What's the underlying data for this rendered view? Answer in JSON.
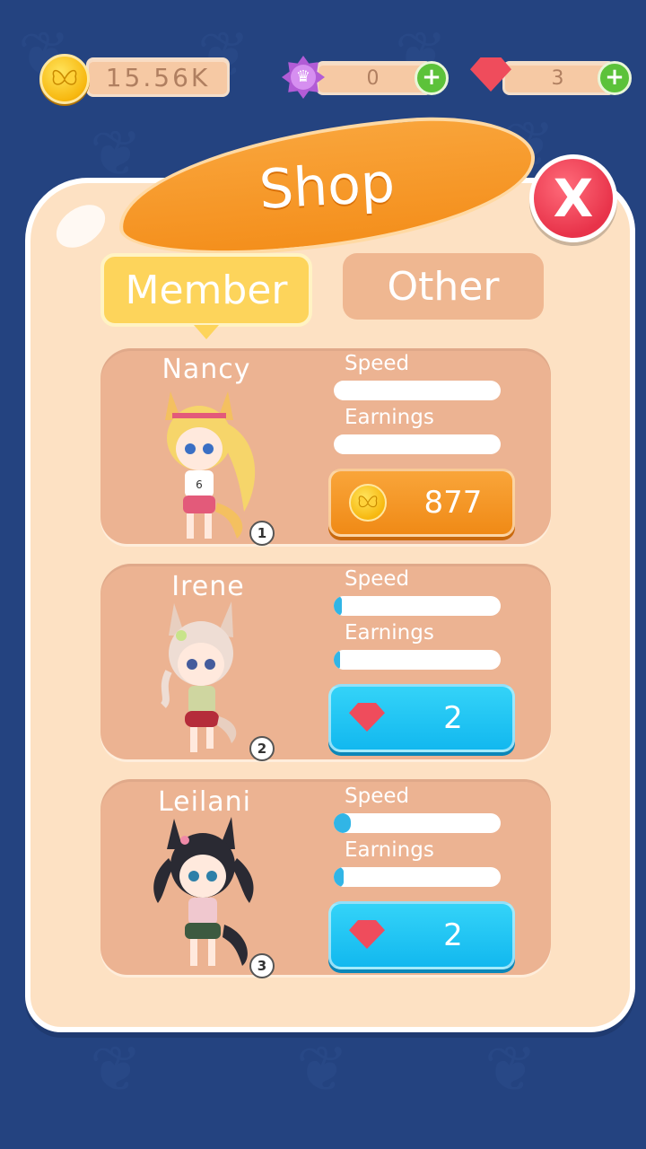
{
  "currency": {
    "coins": "15.56K",
    "stars": "0",
    "gems": "3",
    "coin_icon": "butterfly-coin-icon",
    "star_icon": "crown-star-icon",
    "gem_icon": "red-gem-icon",
    "plus_label": "+"
  },
  "shop": {
    "title": "Shop",
    "close_label": "X",
    "tabs": [
      {
        "label": "Member",
        "active": true
      },
      {
        "label": "Other",
        "active": false
      }
    ]
  },
  "labels": {
    "speed": "Speed",
    "earnings": "Earnings"
  },
  "members": [
    {
      "name": "Nancy",
      "rank": "1",
      "speed": 0.0,
      "earnings": 0.0,
      "price": "877",
      "currency": "coin",
      "hair": "#f6d56a",
      "ears": "#f4c060"
    },
    {
      "name": "Irene",
      "rank": "2",
      "speed": 0.05,
      "earnings": 0.04,
      "price": "2",
      "currency": "gem",
      "hair": "#eeddd4",
      "ears": "#e8cfc0"
    },
    {
      "name": "Leilani",
      "rank": "3",
      "speed": 0.1,
      "earnings": 0.06,
      "price": "2",
      "currency": "gem",
      "hair": "#2a2a33",
      "ears": "#2a2a33"
    }
  ],
  "colors": {
    "background": "#244380",
    "panel": "#fde1c3",
    "card": "#ecb392",
    "banner": "#f59a2a",
    "close": "#e8334a",
    "tab_active": "#fdd45b",
    "buy_coin": "#f49520",
    "buy_gem": "#22c3f3"
  }
}
